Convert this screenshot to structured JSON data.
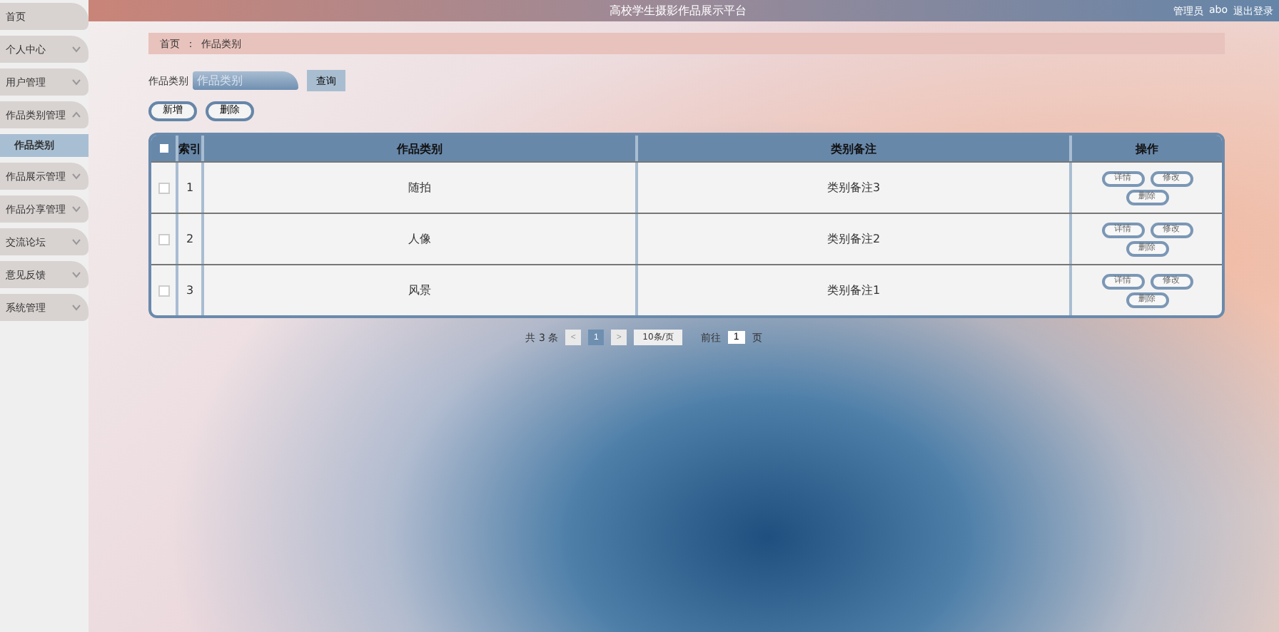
{
  "header": {
    "title": "高校学生摄影作品展示平台",
    "user_role": "管理员",
    "user_name": "abo",
    "logout": "退出登录"
  },
  "sidebar": {
    "items": [
      {
        "label": "首页",
        "kind": "link",
        "selected": false
      },
      {
        "label": "个人中心",
        "kind": "menu",
        "expanded": false,
        "selected": false
      },
      {
        "label": "用户管理",
        "kind": "menu",
        "expanded": false,
        "selected": false
      },
      {
        "label": "作品类别管理",
        "kind": "menu",
        "expanded": true,
        "selected": false,
        "children": [
          {
            "label": "作品类别",
            "selected": true
          }
        ]
      },
      {
        "label": "作品展示管理",
        "kind": "menu",
        "expanded": false,
        "selected": false
      },
      {
        "label": "作品分享管理",
        "kind": "menu",
        "expanded": false,
        "selected": false
      },
      {
        "label": "交流论坛",
        "kind": "menu",
        "expanded": false,
        "selected": false
      },
      {
        "label": "意见反馈",
        "kind": "menu",
        "expanded": false,
        "selected": false
      },
      {
        "label": "系统管理",
        "kind": "menu",
        "expanded": false,
        "selected": false
      }
    ]
  },
  "breadcrumb": [
    "首页",
    "：",
    "作品类别"
  ],
  "search": {
    "label": "作品类别",
    "placeholder": "作品类别",
    "button": "查询"
  },
  "actions": [
    "新增",
    "删除"
  ],
  "table": {
    "all_checked": false,
    "columns": [
      "索引",
      "作品类别",
      "类别备注",
      "操作"
    ],
    "rows": [
      {
        "checked": false,
        "index": "1",
        "category": "随拍",
        "remark": "类别备注3",
        "operations": [
          "详情",
          "修改",
          "删除"
        ]
      },
      {
        "checked": false,
        "index": "2",
        "category": "人像",
        "remark": "类别备注2",
        "operations": [
          "详情",
          "修改",
          "删除"
        ]
      },
      {
        "checked": false,
        "index": "3",
        "category": "风景",
        "remark": "类别备注1",
        "operations": [
          "详情",
          "修改",
          "删除"
        ]
      }
    ]
  },
  "pagination": {
    "total": "共 3 条",
    "prev": "<",
    "pages": [
      {
        "label": "1",
        "selected": true
      }
    ],
    "next": ">",
    "page_size": "10条/页",
    "goto_label": "前往",
    "goto_value": "1",
    "goto_suffix": "页"
  }
}
